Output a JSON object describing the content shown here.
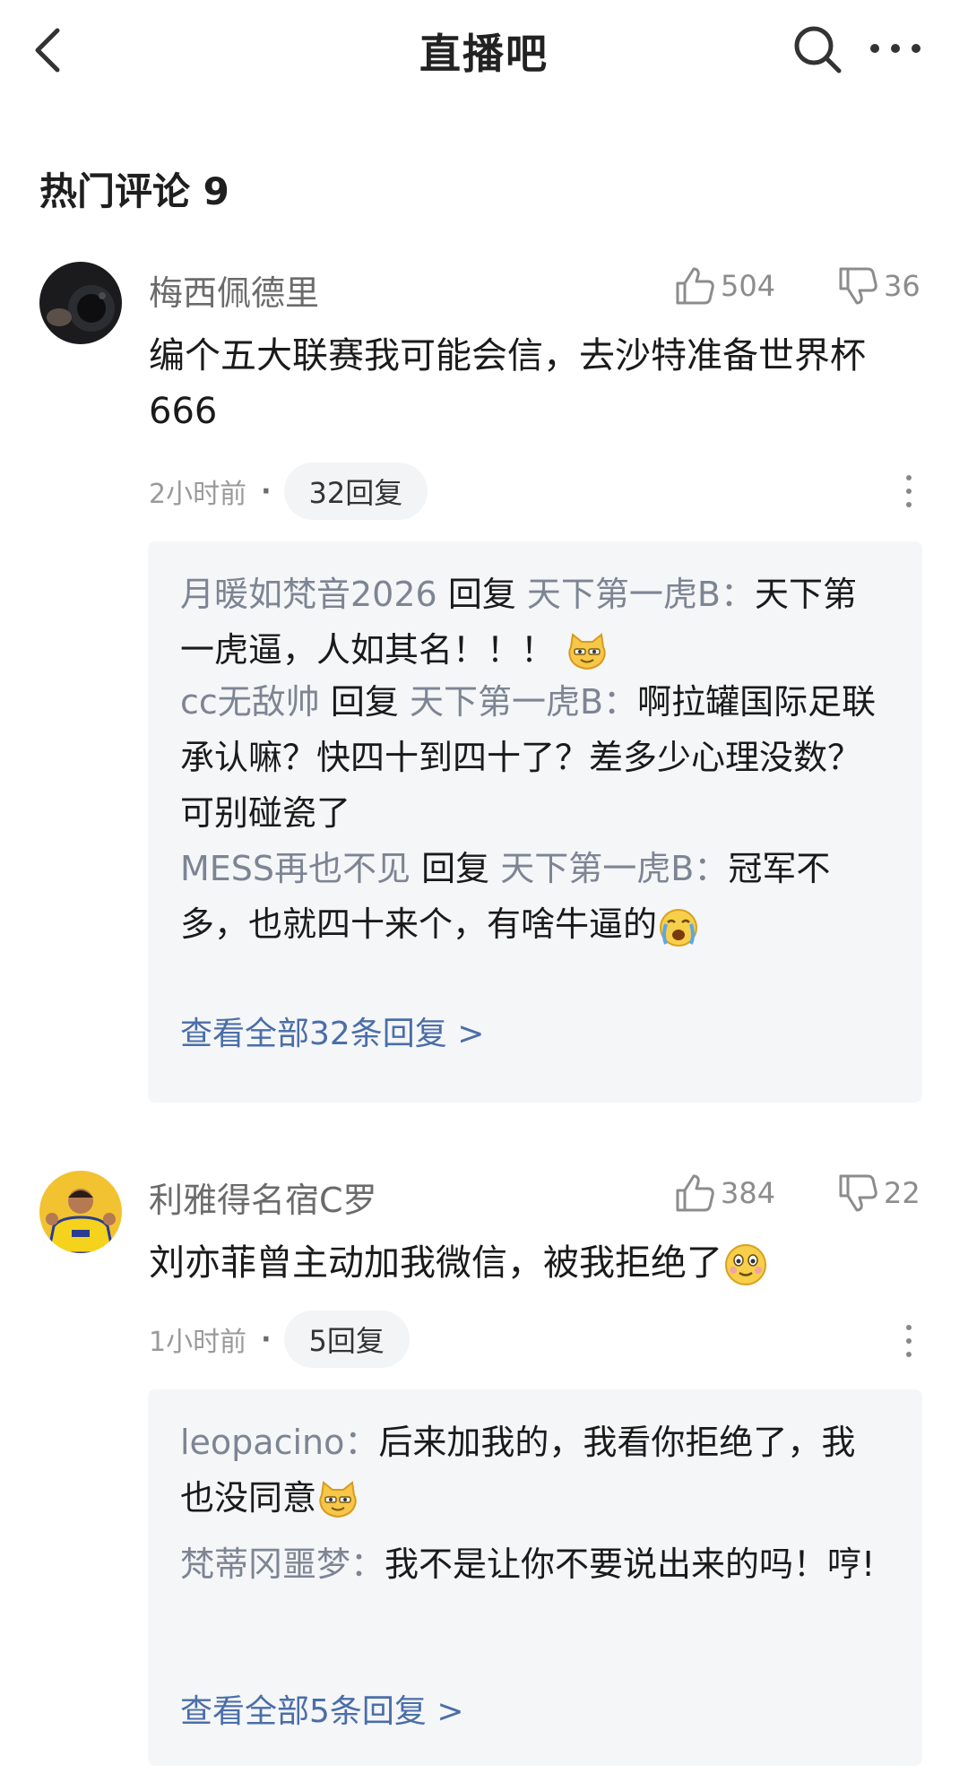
{
  "header": {
    "title": "直播吧"
  },
  "section": {
    "title": "热门评论 9"
  },
  "comments": [
    {
      "user": "梅西佩德里",
      "likes": "504",
      "dislikes": "36",
      "text": "编个五大联赛我可能会信，去沙特准备世界杯666",
      "time": "2小时前",
      "reply_count": "32回复",
      "replies": [
        {
          "name": "月暖如梵音2026",
          "verb": "回复",
          "target": "天下第一虎B",
          "text": "天下第一虎逼，人如其名！！！"
        },
        {
          "name": "cc无敌帅",
          "verb": "回复",
          "target": "天下第一虎B",
          "text": "啊拉罐国际足联承认嘛？快四十到四十了？差多少心理没数？可别碰瓷了"
        },
        {
          "name": "MESS再也不见",
          "verb": "回复",
          "target": "天下第一虎B",
          "text": "冠军不多，也就四十来个，有啥牛逼的"
        }
      ],
      "view_all": "查看全部32条回复 >"
    },
    {
      "user": "利雅得名宿C罗",
      "likes": "384",
      "dislikes": "22",
      "text": "刘亦菲曾主动加我微信，被我拒绝了",
      "time": "1小时前",
      "reply_count": "5回复",
      "replies": [
        {
          "name": "leopacino",
          "text": "后来加我的，我看你拒绝了，我也没同意"
        },
        {
          "name": "梵蒂冈噩梦",
          "text": "我不是让你不要说出来的吗！哼!"
        }
      ],
      "view_all": "查看全部5条回复 >"
    }
  ],
  "icons": [
    "back-arrow-icon",
    "search-icon",
    "more-icon",
    "thumb-up-icon",
    "thumb-down-icon",
    "kebab-icon",
    "grinning-cat-emoji",
    "crying-emoji",
    "smile-emoji"
  ],
  "colors": {
    "link": "#4a6ea8",
    "name": "#7d8593",
    "reply_bg": "#f5f6f8"
  }
}
